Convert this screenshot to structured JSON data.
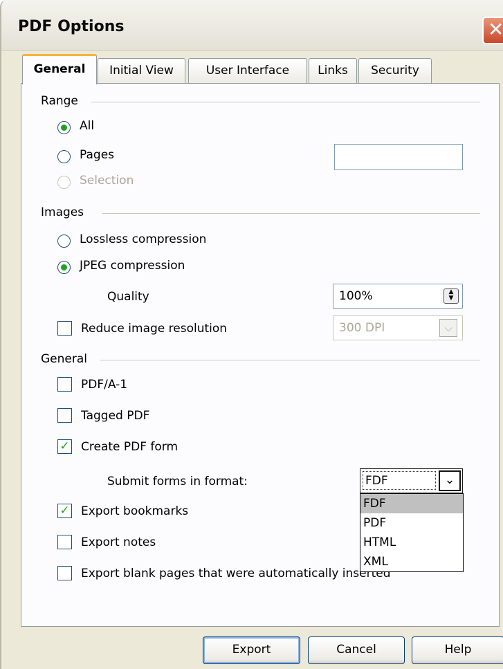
{
  "window": {
    "title": "PDF Options",
    "close_symbol": "✕"
  },
  "tabs": [
    "General",
    "Initial View",
    "User Interface",
    "Links",
    "Security"
  ],
  "range": {
    "heading": "Range",
    "all_label": "All",
    "pages_label": "Pages",
    "pages_value": "",
    "selection_label": "Selection"
  },
  "images": {
    "heading": "Images",
    "lossless_label": "Lossless compression",
    "jpeg_label": "JPEG compression",
    "quality_label": "Quality",
    "quality_value": "100%",
    "reduce_label": "Reduce image resolution",
    "resolution_value": "300 DPI"
  },
  "general": {
    "heading": "General",
    "pdfa_label": "PDF/A-1",
    "tagged_label": "Tagged PDF",
    "create_form_label": "Create PDF form",
    "submit_label": "Submit forms in format:",
    "submit_value": "FDF",
    "format_options": [
      "FDF",
      "PDF",
      "HTML",
      "XML"
    ],
    "bookmarks_label": "Export bookmarks",
    "notes_label": "Export notes",
    "blank_pages_label": "Export blank pages that were automatically inserted"
  },
  "buttons": {
    "export": "Export",
    "cancel": "Cancel",
    "help": "Help"
  },
  "colors": {
    "accent_tab": "#f5b43b",
    "check": "#21a121",
    "window_bg": "#ece9d8"
  }
}
